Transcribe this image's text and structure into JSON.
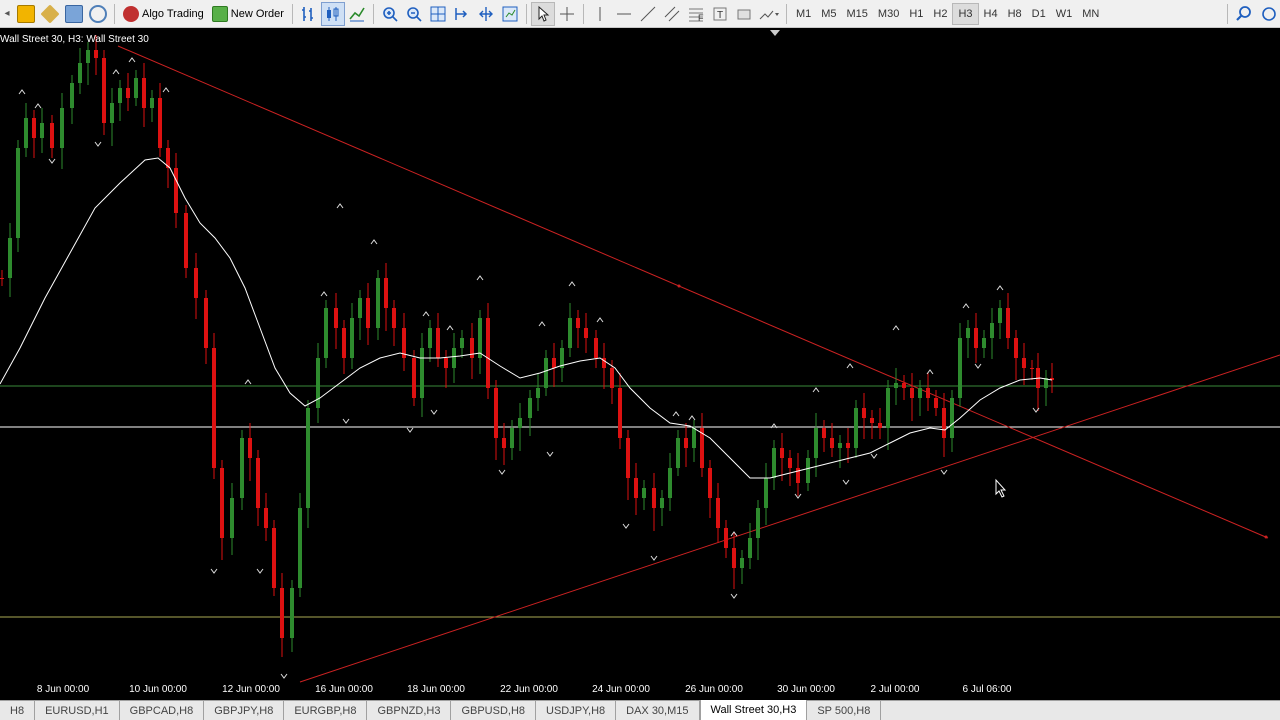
{
  "toolbar": {
    "algo_trading_label": "Algo Trading",
    "new_order_label": "New Order",
    "timeframes": [
      "M1",
      "M5",
      "M15",
      "M30",
      "H1",
      "H2",
      "H3",
      "H4",
      "H8",
      "D1",
      "W1",
      "MN"
    ],
    "active_timeframe": "H3"
  },
  "chart": {
    "label": "Wall Street 30, H3:  Wall Street 30",
    "x_labels": [
      "8 Jun 00:00",
      "10 Jun 00:00",
      "12 Jun 00:00",
      "16 Jun 00:00",
      "18 Jun 00:00",
      "22 Jun 00:00",
      "24 Jun 00:00",
      "26 Jun 00:00",
      "30 Jun 00:00",
      "2 Jul 00:00",
      "6 Jul 06:00"
    ],
    "colors": {
      "bull": "#2e8b2e",
      "bear": "#dd1111",
      "ma": "#ffffff",
      "trendline": "#cc2222",
      "horizontal_green": "#3a8a3a",
      "horizontal_white": "#ffffff",
      "horizontal_yellow": "#aaaa55"
    }
  },
  "tabs": [
    "H8",
    "EURUSD,H1",
    "GBPCAD,H8",
    "GBPJPY,H8",
    "EURGBP,H8",
    "GBPNZD,H3",
    "GBPUSD,H8",
    "USDJPY,H8",
    "DAX 30,M15",
    "Wall Street 30,H3",
    "SP 500,H8"
  ],
  "active_tab": "Wall Street 30,H3"
}
